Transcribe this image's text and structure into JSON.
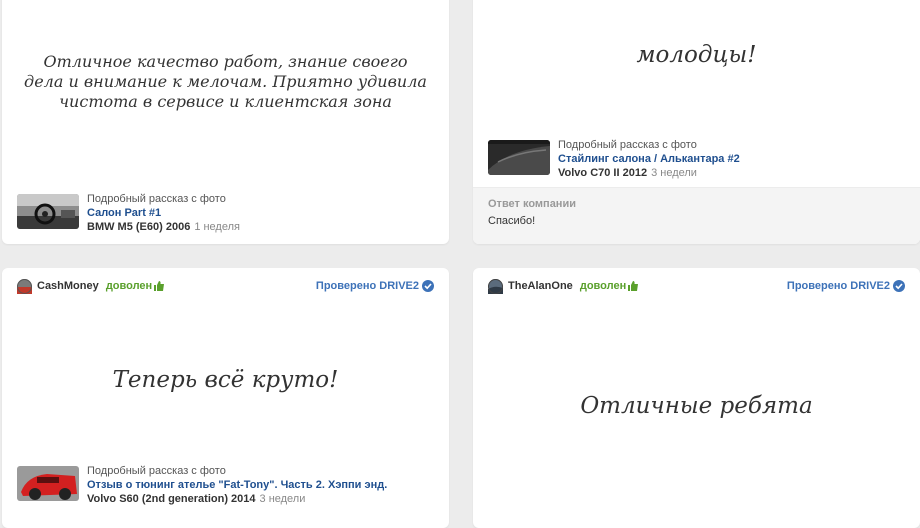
{
  "reviews": [
    {
      "quote": "Отличное качество работ, знание своего дела и внимание к мелочам. Приятно удивила чистота в сервисе и клиентская зона",
      "story": {
        "caption": "Подробный рассказ с фото",
        "title": "Салон Part #1",
        "car": "BMW M5 (E60) 2006",
        "time": "1 неделя"
      }
    },
    {
      "quote": "молодцы!",
      "story": {
        "caption": "Подробный рассказ с фото",
        "title": "Стайлинг салона / Алькантара #2",
        "car": "Volvo C70 II 2012",
        "time": "3 недели"
      },
      "reply": {
        "label": "Ответ компании",
        "text": "Спасибо!"
      }
    },
    {
      "user": "CashMoney",
      "status": "доволен",
      "verified": "Проверено DRIVE2",
      "quote": "Теперь всё круто!",
      "story": {
        "caption": "Подробный рассказ с фото",
        "title": "Отзыв о тюнинг ателье \"Fat-Tony\". Часть 2. Хэппи энд.",
        "car": "Volvo S60 (2nd generation) 2014",
        "time": "3 недели"
      }
    },
    {
      "user": "TheAlanOne",
      "status": "доволен",
      "verified": "Проверено DRIVE2",
      "quote": "Отличные ребята"
    }
  ],
  "colors": {
    "link": "#1f4f8f",
    "status": "#5aa02c",
    "verified": "#3d72b8",
    "background": "#ececec"
  },
  "icons": [
    "thumbs-up-icon",
    "verified-check-icon"
  ]
}
